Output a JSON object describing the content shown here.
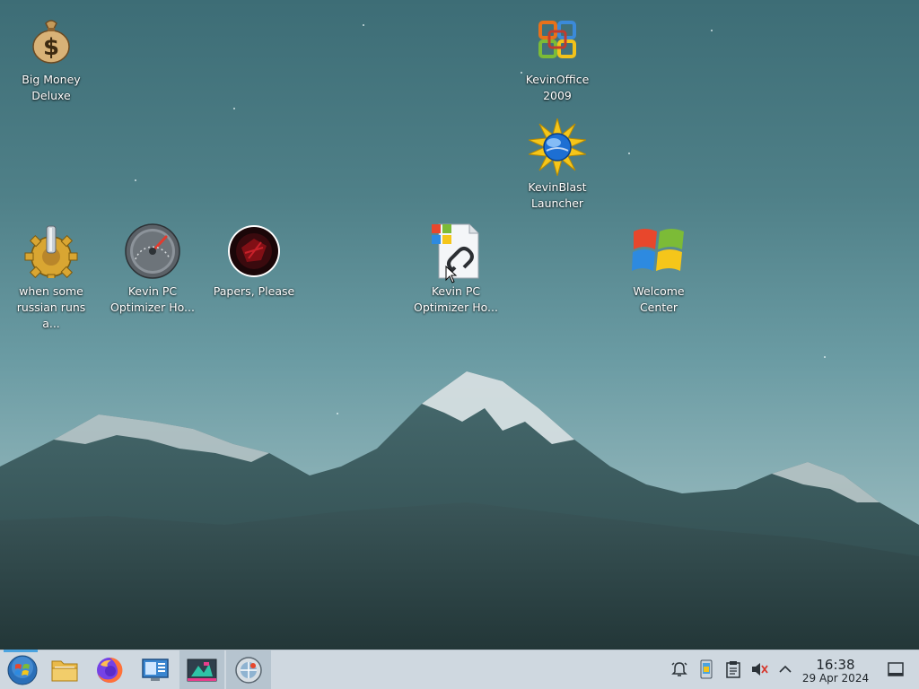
{
  "desktop": {
    "icons": [
      {
        "label": "Big Money\nDeluxe",
        "icon": "money-bag-icon"
      },
      {
        "label": "KevinOffice\n2009",
        "icon": "office-logo-icon"
      },
      {
        "label": "KevinBlast\nLauncher",
        "icon": "sun-globe-icon"
      },
      {
        "label": "when some\nrussian runs a...",
        "icon": "gear-icon"
      },
      {
        "label": "Kevin PC\nOptimizer Ho...",
        "icon": "speedometer-icon"
      },
      {
        "label": "Papers, Please",
        "icon": "papers-please-icon"
      },
      {
        "label": "Kevin PC\nOptimizer Ho...",
        "icon": "shortcut-file-icon"
      },
      {
        "label": "Welcome\nCenter",
        "icon": "windows-flag-icon"
      }
    ]
  },
  "taskbar": {
    "launchers": [
      {
        "name": "start-menu",
        "icon": "windows-orb-icon"
      },
      {
        "name": "file-manager",
        "icon": "folder-icon"
      },
      {
        "name": "firefox",
        "icon": "firefox-icon"
      },
      {
        "name": "control-panel",
        "icon": "monitor-settings-icon"
      },
      {
        "name": "app-window",
        "icon": "app-window-icon"
      },
      {
        "name": "active-window",
        "icon": "globe-window-icon"
      }
    ],
    "tray": [
      {
        "name": "notifications",
        "icon": "alarm-bell-icon"
      },
      {
        "name": "phone-device",
        "icon": "device-icon"
      },
      {
        "name": "clipboard",
        "icon": "clipboard-icon"
      },
      {
        "name": "volume",
        "icon": "speaker-muted-icon"
      },
      {
        "name": "show-hidden",
        "icon": "chevron-up-icon"
      }
    ],
    "clock": {
      "time": "16:38",
      "date": "29 Apr 2024"
    }
  },
  "colors": {
    "sky_top": "#3d6d76",
    "sky_bottom": "#b7cdd0",
    "taskbar": "#cfd8e0",
    "accent": "#4aa3df"
  }
}
